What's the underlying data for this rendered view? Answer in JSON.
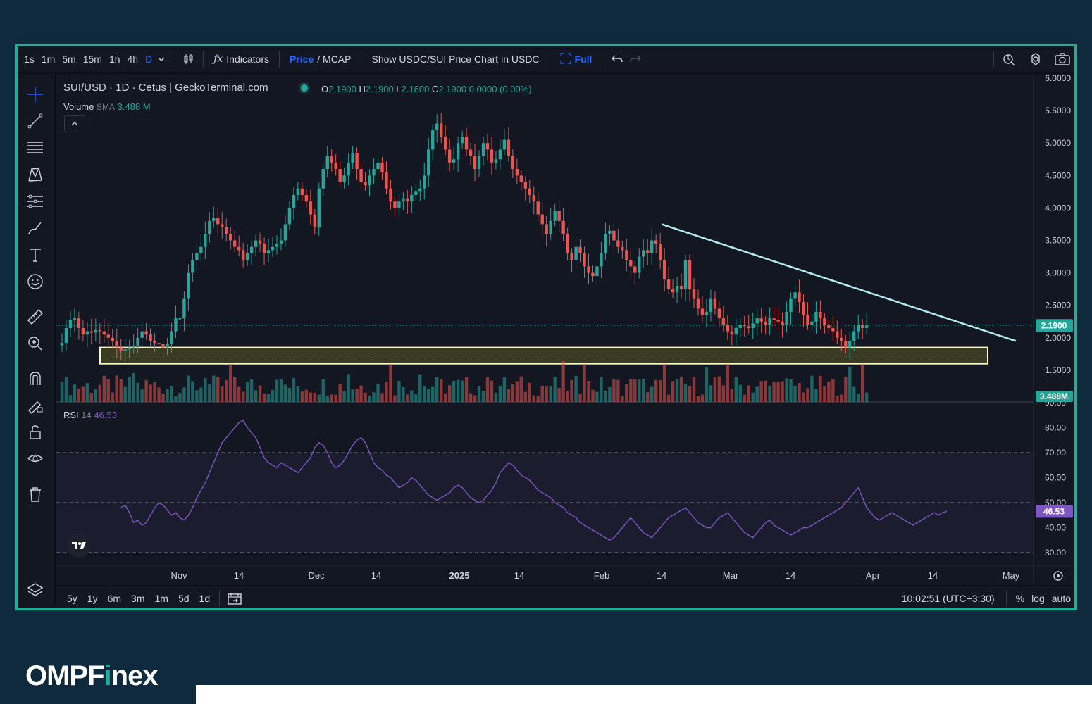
{
  "toolbar": {
    "timeframes": [
      "1s",
      "1m",
      "5m",
      "15m",
      "1h",
      "4h",
      "D"
    ],
    "indicators_label": "Indicators",
    "price_label": "Price",
    "mcap_label": "/ MCAP",
    "show_usdc_label": "Show USDC/SUI Price Chart in USDC",
    "full_label": "Full"
  },
  "legend": {
    "symbol": "SUI/USD · 1D · Cetus | GeckoTerminal.com",
    "o_label": "O",
    "o": "2.1900",
    "h_label": "H",
    "h": "2.1900",
    "l_label": "L",
    "l": "2.1600",
    "c_label": "C",
    "c": "2.1900",
    "change": "0.0000 (0.00%)",
    "volume_label": "Volume",
    "sma_label": "SMA",
    "sma_value": "3.488 M",
    "rsi_label": "RSI",
    "rsi_period": "14",
    "rsi_value": "46.53"
  },
  "bottom": {
    "ranges": [
      "5y",
      "1y",
      "6m",
      "3m",
      "1m",
      "5d",
      "1d"
    ],
    "time": "10:02:51 (UTC+3:30)",
    "pct": "%",
    "log": "log",
    "auto": "auto"
  },
  "brand": {
    "prefix": "OMPF",
    "i": "i",
    "suffix": "nex"
  },
  "colors": {
    "up": "#26a69a",
    "down": "#ef5350",
    "rsi": "#7e57c2",
    "trendline": "#b2ebf2",
    "support": "#fff9c4"
  },
  "chart_data": {
    "type": "candlestick",
    "symbol": "SUI/USD",
    "x_ticks": [
      "Nov",
      "14",
      "Dec",
      "14",
      "2025",
      "14",
      "Feb",
      "14",
      "Mar",
      "14",
      "Apr",
      "14",
      "May"
    ],
    "price_axis": {
      "ticks": [
        "6.0000",
        "5.5000",
        "5.0000",
        "4.5000",
        "4.0000",
        "3.5000",
        "3.0000",
        "2.5000",
        "2.0000",
        "1.5000"
      ],
      "ylim": [
        1.5,
        6.0
      ],
      "last_price": "2.1900"
    },
    "volume_badge": "3.488M",
    "rsi_axis": {
      "ticks": [
        "90.00",
        "80.00",
        "70.00",
        "60.00",
        "50.00",
        "40.00",
        "30.00"
      ],
      "bands": [
        30,
        70
      ],
      "mid": 50,
      "last": "46.53"
    },
    "closes": [
      1.92,
      2.15,
      2.28,
      2.3,
      2.15,
      2.05,
      2.1,
      2.08,
      2.12,
      2.1,
      2.05,
      2.0,
      1.95,
      1.85,
      1.8,
      1.82,
      1.85,
      1.88,
      2.0,
      2.1,
      2.05,
      1.95,
      1.92,
      1.9,
      1.85,
      1.9,
      2.1,
      2.3,
      2.3,
      2.6,
      3.0,
      3.2,
      3.3,
      3.4,
      3.6,
      3.8,
      3.85,
      3.75,
      3.7,
      3.6,
      3.5,
      3.4,
      3.35,
      3.2,
      3.3,
      3.4,
      3.5,
      3.45,
      3.3,
      3.35,
      3.4,
      3.45,
      3.5,
      3.75,
      4.0,
      4.2,
      4.3,
      4.2,
      4.1,
      3.9,
      3.7,
      4.3,
      4.6,
      4.8,
      4.7,
      4.6,
      4.4,
      4.5,
      4.7,
      4.85,
      4.6,
      4.4,
      4.35,
      4.5,
      4.6,
      4.7,
      4.55,
      4.3,
      4.1,
      4.0,
      4.1,
      4.15,
      4.1,
      4.2,
      4.25,
      4.3,
      4.5,
      4.9,
      5.2,
      5.3,
      5.1,
      4.9,
      4.7,
      4.75,
      5.0,
      5.1,
      4.9,
      4.8,
      4.6,
      4.8,
      5.0,
      4.9,
      4.7,
      4.75,
      4.9,
      5.05,
      4.8,
      4.6,
      4.5,
      4.4,
      4.3,
      4.2,
      4.1,
      3.9,
      3.75,
      3.6,
      3.8,
      3.95,
      3.8,
      3.6,
      3.3,
      3.2,
      3.4,
      3.3,
      3.1,
      3.0,
      2.95,
      3.1,
      3.3,
      3.6,
      3.65,
      3.5,
      3.4,
      3.35,
      3.2,
      3.1,
      3.0,
      3.25,
      3.35,
      3.3,
      3.5,
      3.45,
      3.2,
      2.9,
      2.75,
      2.7,
      2.8,
      2.75,
      3.2,
      2.75,
      2.6,
      2.45,
      2.35,
      2.4,
      2.6,
      2.45,
      2.3,
      2.2,
      2.1,
      2.05,
      2.15,
      2.2,
      2.18,
      2.15,
      2.22,
      2.3,
      2.25,
      2.2,
      2.3,
      2.28,
      2.25,
      2.2,
      2.4,
      2.6,
      2.7,
      2.55,
      2.35,
      2.2,
      2.25,
      2.4,
      2.3,
      2.2,
      2.15,
      2.1,
      2.0,
      1.95,
      1.85,
      1.95,
      2.1,
      2.2,
      2.15,
      2.19
    ],
    "rsi": [
      48,
      49,
      46,
      42,
      43,
      41,
      42,
      45,
      48,
      50,
      49,
      47,
      45,
      46,
      44,
      43,
      45,
      48,
      52,
      55,
      58,
      62,
      66,
      70,
      74,
      76,
      78,
      80,
      82,
      83,
      80,
      78,
      76,
      72,
      68,
      66,
      65,
      64,
      66,
      65,
      64,
      63,
      62,
      64,
      66,
      68,
      72,
      74,
      73,
      70,
      66,
      64,
      65,
      67,
      70,
      73,
      75,
      76,
      74,
      70,
      66,
      64,
      63,
      61,
      60,
      58,
      56,
      57,
      58,
      60,
      59,
      57,
      55,
      53,
      52,
      51,
      52,
      53,
      54,
      56,
      57,
      56,
      54,
      52,
      51,
      50,
      51,
      53,
      55,
      58,
      62,
      64,
      66,
      65,
      63,
      61,
      60,
      59,
      57,
      55,
      54,
      53,
      52,
      50,
      49,
      48,
      46,
      45,
      44,
      42,
      41,
      40,
      39,
      38,
      37,
      36,
      35,
      36,
      38,
      40,
      42,
      44,
      42,
      40,
      38,
      37,
      36,
      38,
      40,
      42,
      44,
      45,
      46,
      47,
      48,
      46,
      44,
      42,
      41,
      40,
      40,
      42,
      44,
      45,
      46,
      44,
      42,
      40,
      38,
      37,
      36,
      38,
      40,
      42,
      43,
      41,
      40,
      39,
      38,
      37,
      38,
      39,
      40,
      40,
      41,
      42,
      43,
      44,
      45,
      46,
      47,
      48,
      50,
      52,
      54,
      56,
      52,
      48,
      46,
      44,
      43,
      44,
      45,
      46,
      45,
      44,
      43,
      42,
      41,
      42,
      43,
      44,
      45,
      46,
      45,
      46,
      46.53
    ],
    "trendline": {
      "from": {
        "x": "Feb 14",
        "y": 3.75
      },
      "to": {
        "x": "May",
        "y": 1.95
      }
    },
    "support_zone": {
      "top": 1.85,
      "bottom": 1.6,
      "mid": 1.72
    }
  }
}
